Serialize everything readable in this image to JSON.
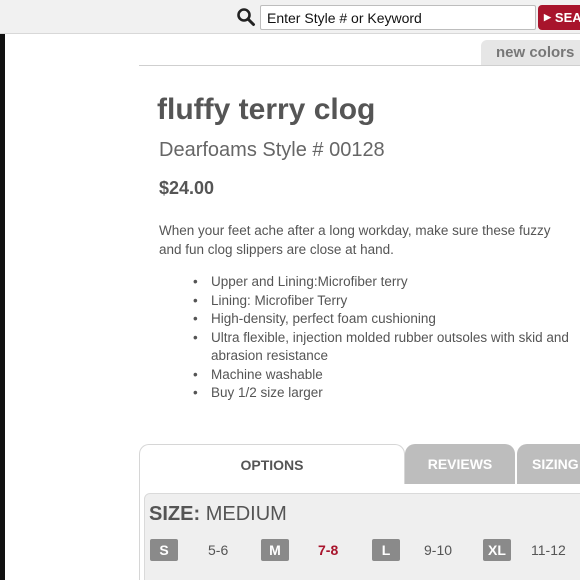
{
  "search": {
    "placeholder": "Enter Style # or Keyword",
    "button_label": "SEA",
    "icon": "search-icon"
  },
  "new_colors_tab": "new colors",
  "product": {
    "title": "fluffy terry clog",
    "style_line": "Dearfoams Style # 00128",
    "price": "$24.00",
    "description_line1": "When your feet ache after a long workday, make sure these fuzzy",
    "description_line2": "and fun clog slippers are close at hand.",
    "features": [
      "Upper and Lining:Microfiber terry",
      "Lining: Microfiber Terry",
      "High-density, perfect foam cushioning",
      "Ultra flexible, injection molded rubber outsoles with skid and abrasion resistance",
      "Machine washable",
      "Buy 1/2 size larger"
    ]
  },
  "tabs": {
    "options": "OPTIONS",
    "reviews": "REVIEWS",
    "sizing": "SIZING"
  },
  "size": {
    "label": "SIZE:",
    "selected": "MEDIUM",
    "options": [
      {
        "code": "S",
        "range": "5-6"
      },
      {
        "code": "M",
        "range": "7-8"
      },
      {
        "code": "L",
        "range": "9-10"
      },
      {
        "code": "XL",
        "range": "11-12"
      }
    ]
  },
  "colors": {
    "accent": "#a8142c",
    "size_badge": "#8a8a8a",
    "inactive_tab": "#bdbdbd"
  }
}
